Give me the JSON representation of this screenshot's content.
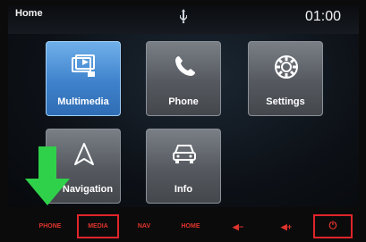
{
  "header": {
    "title": "Home",
    "time": "01:00",
    "usb_icon": "usb-icon"
  },
  "tiles": [
    {
      "label": "Multimedia",
      "icon": "multimedia-icon",
      "selected": true
    },
    {
      "label": "Phone",
      "icon": "phone-icon",
      "selected": false
    },
    {
      "label": "Settings",
      "icon": "gear-icon",
      "selected": false
    },
    {
      "label": "Navigation",
      "icon": "navigation-arrow-icon",
      "selected": false
    },
    {
      "label": "Info",
      "icon": "car-icon",
      "selected": false
    }
  ],
  "softkeys": [
    {
      "label": "PHONE"
    },
    {
      "label": "MEDIA",
      "highlighted": true
    },
    {
      "label": "NAV"
    },
    {
      "label": "HOME"
    },
    {
      "label": "◀−"
    },
    {
      "label": "◀+"
    },
    {
      "label": "⏻",
      "highlighted": true
    }
  ],
  "colors": {
    "accent_blue": "#3f82cc",
    "softkey_red": "#e0342c",
    "highlight_box": "#e0242a",
    "pointer_arrow": "#2fd14a"
  }
}
